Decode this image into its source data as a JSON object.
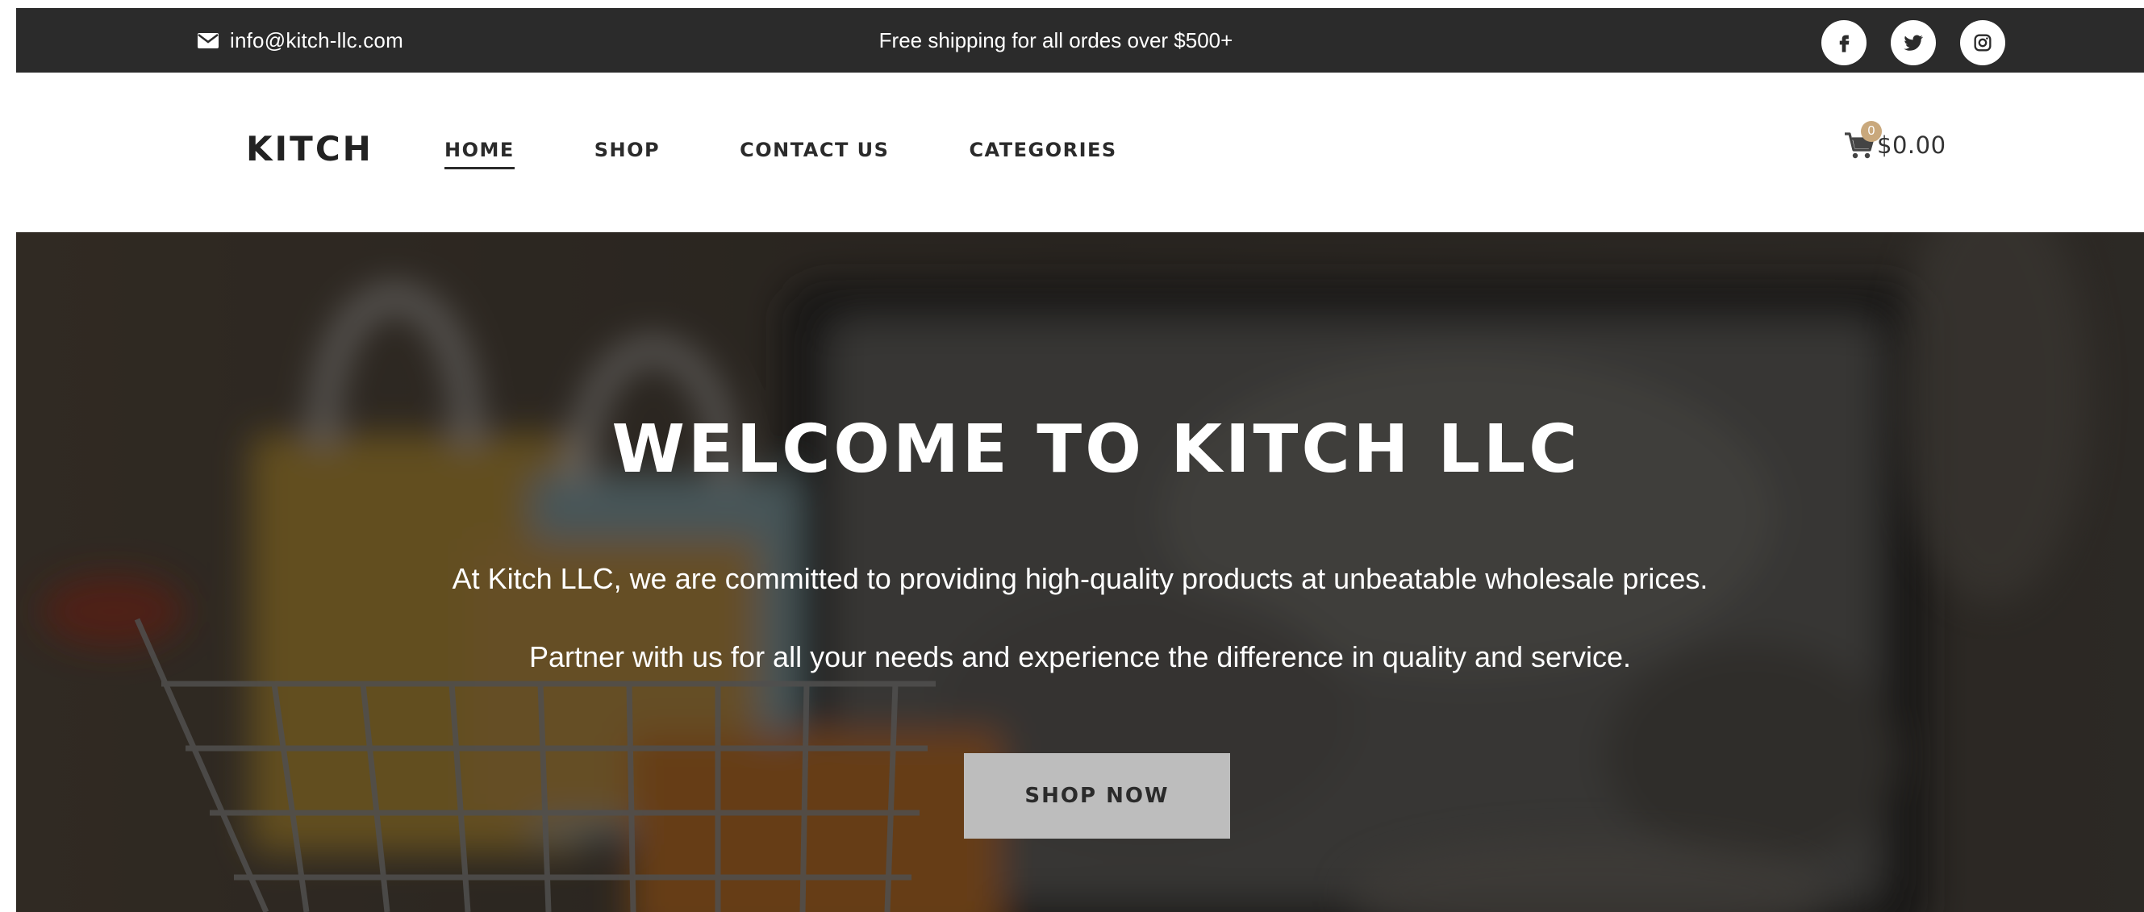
{
  "topbar": {
    "email": "info@kitch-llc.com",
    "shipping": "Free shipping for all ordes over $500+",
    "socials": [
      "facebook-icon",
      "twitter-icon",
      "instagram-icon"
    ]
  },
  "nav": {
    "logo": "KITCH",
    "links": [
      {
        "label": "HOME",
        "active": true
      },
      {
        "label": "SHOP",
        "active": false
      },
      {
        "label": "CONTACT US",
        "active": false
      },
      {
        "label": "CATEGORIES",
        "active": false
      }
    ],
    "cart_count": "0",
    "cart_total": "$0.00"
  },
  "hero": {
    "title": "WELCOME TO KITCH LLC",
    "line1": "At Kitch LLC, we are committed to providing high-quality products at unbeatable wholesale prices.",
    "line2": "Partner with us for all your needs and experience the difference in quality and service.",
    "button": "SHOP NOW"
  },
  "colors": {
    "topbar_bg": "#2b2b2b",
    "accent_badge": "#c9a87c",
    "button_bg": "#bdbdbd",
    "text_dark": "#2b2b2b"
  }
}
